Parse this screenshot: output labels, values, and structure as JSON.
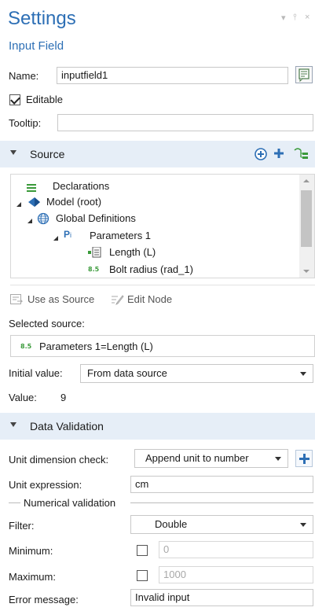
{
  "header": {
    "title": "Settings",
    "subtitle": "Input Field",
    "window_controls": [
      "▾",
      "⫯",
      "×"
    ]
  },
  "form": {
    "name_label": "Name:",
    "name_value": "inputfield1",
    "editable_label": "Editable",
    "editable_checked": true,
    "tooltip_label": "Tooltip:",
    "tooltip_value": ""
  },
  "source_section": {
    "title": "Source",
    "tree": [
      {
        "label": "Declarations",
        "icon": "declarations-icon"
      },
      {
        "label": "Model (root)",
        "icon": "model-icon"
      },
      {
        "label": "Global Definitions",
        "icon": "globe-icon"
      },
      {
        "label": "Parameters 1",
        "icon": "parameters-icon",
        "tag": "Pi"
      },
      {
        "label": "Length (L)",
        "icon": "parameter-item-icon"
      },
      {
        "label": "Bolt radius (rad_1)",
        "icon": "parameter-value-icon",
        "tag": "8.5"
      }
    ],
    "use_as_source_label": "Use as Source",
    "edit_node_label": "Edit Node",
    "selected_source_label": "Selected source:",
    "selected_source_tag": "8.5",
    "selected_source_value": "Parameters 1=Length (L)",
    "initial_value_label": "Initial value:",
    "initial_value_selected": "From data source",
    "value_label": "Value:",
    "value": "9"
  },
  "validation_section": {
    "title": "Data Validation",
    "unit_dim_label": "Unit dimension check:",
    "unit_dim_selected": "Append unit to number",
    "unit_expr_label": "Unit expression:",
    "unit_expr_value": "cm",
    "numerical_group_label": "Numerical validation",
    "filter_label": "Filter:",
    "filter_selected": "Double",
    "minimum_label": "Minimum:",
    "minimum_value": "0",
    "minimum_checked": false,
    "maximum_label": "Maximum:",
    "maximum_value": "1000",
    "maximum_checked": false,
    "error_label": "Error message:",
    "error_value": "Invalid input"
  },
  "colors": {
    "accent": "#2d6fb5",
    "section_bg": "#e6eef7",
    "green": "#3a9a3a"
  }
}
